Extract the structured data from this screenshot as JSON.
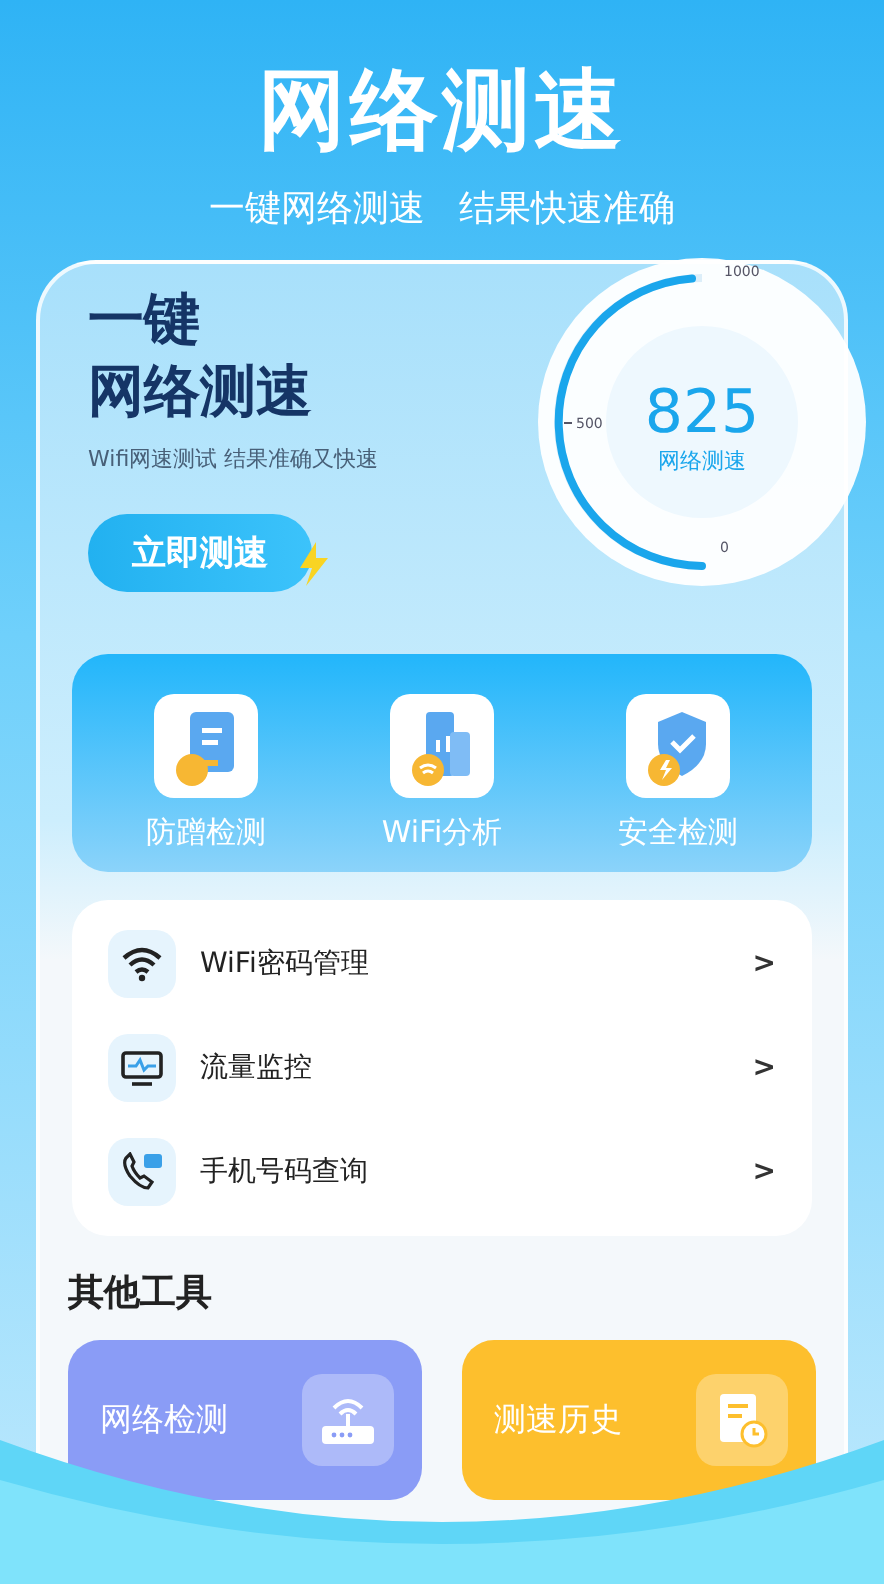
{
  "header": {
    "title": "网络测速",
    "subtitle": "一键网络测速   结果快速准确"
  },
  "hero": {
    "title_line1": "一键",
    "title_line2": "网络测速",
    "tagline": "Wifi网速测试 结果准确又快速",
    "button": "立即测速"
  },
  "gauge": {
    "value": "825",
    "caption": "网络测速",
    "ticks": [
      "1000",
      "500",
      "0"
    ]
  },
  "features": [
    {
      "kind": "document",
      "label": "防蹭检测"
    },
    {
      "kind": "wifi",
      "label": "WiFi分析"
    },
    {
      "kind": "shield",
      "label": "安全检测"
    }
  ],
  "menu": [
    {
      "kind": "wifi",
      "label": "WiFi密码管理",
      "arrow": ">"
    },
    {
      "kind": "monitor",
      "label": "流量监控",
      "arrow": ">"
    },
    {
      "kind": "phone",
      "label": "手机号码查询",
      "arrow": ">"
    }
  ],
  "other_tools": {
    "heading": "其他工具",
    "items": [
      {
        "kind": "router",
        "label": "网络检测",
        "color": "#8a9cf6"
      },
      {
        "kind": "history",
        "label": "测速历史",
        "color": "#fdbf2d"
      }
    ]
  }
}
